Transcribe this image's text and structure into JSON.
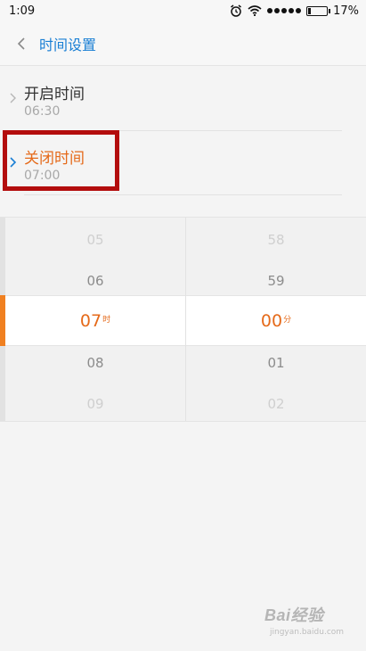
{
  "status_bar": {
    "time": "1:09",
    "battery": "17%",
    "battery_level": 0.17
  },
  "header": {
    "title": "时间设置"
  },
  "list": {
    "items": [
      {
        "label": "开启时间",
        "value": "06:30"
      },
      {
        "label": "关闭时间",
        "value": "07:00"
      }
    ]
  },
  "picker": {
    "hours": {
      "far_above": "05",
      "near_above": "06",
      "selected": "07",
      "unit": "时",
      "near_below": "08",
      "far_below": "09"
    },
    "minutes": {
      "far_above": "58",
      "near_above": "59",
      "selected": "00",
      "unit": "分",
      "near_below": "01",
      "far_below": "02"
    }
  },
  "colors": {
    "accent_blue": "#1a7fd4",
    "accent_orange": "#e56a1a",
    "highlight_red": "#b30d0d"
  },
  "watermark": {
    "text": "Bai经验",
    "sub": "jingyan.baidu.com"
  }
}
